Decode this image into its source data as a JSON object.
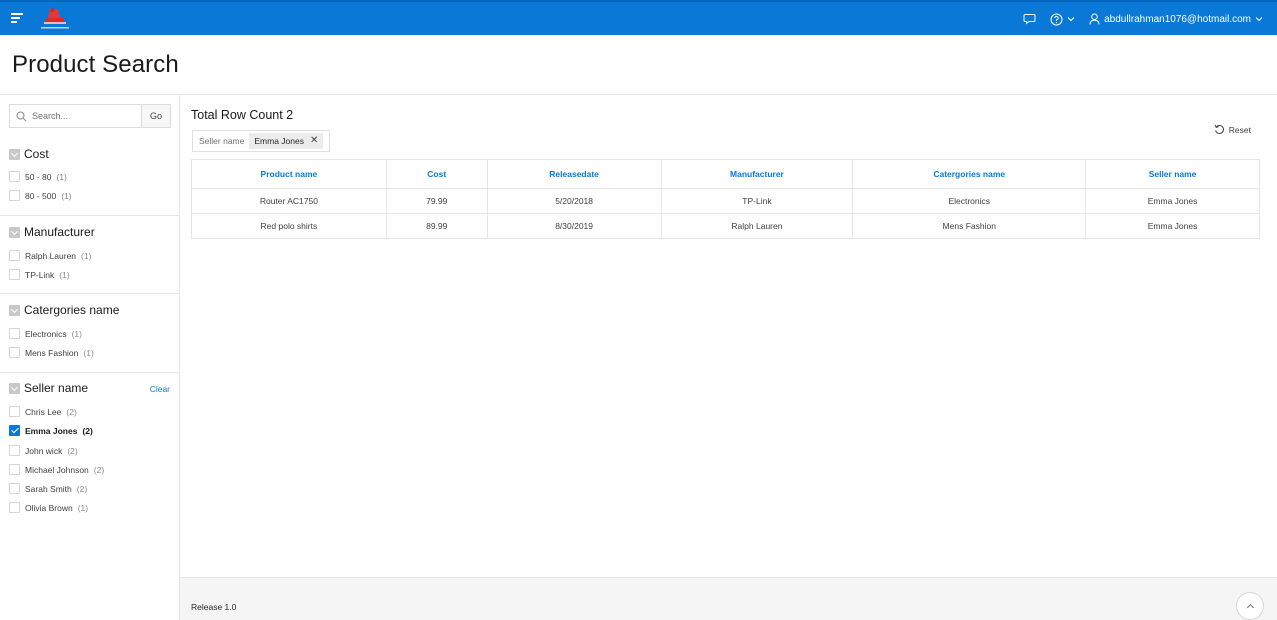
{
  "header": {
    "user_email": "abdullrahman1076@hotmail.com"
  },
  "page": {
    "title": "Product Search"
  },
  "search": {
    "placeholder": "Search...",
    "go_label": "Go"
  },
  "facets": [
    {
      "title": "Cost",
      "options": [
        {
          "label": "50 - 80",
          "count": "(1)",
          "checked": false
        },
        {
          "label": "80 - 500",
          "count": "(1)",
          "checked": false
        }
      ]
    },
    {
      "title": "Manufacturer",
      "options": [
        {
          "label": "Ralph Lauren",
          "count": "(1)",
          "checked": false
        },
        {
          "label": "TP-Link",
          "count": "(1)",
          "checked": false
        }
      ]
    },
    {
      "title": "Catergories name",
      "options": [
        {
          "label": "Electronics",
          "count": "(1)",
          "checked": false
        },
        {
          "label": "Mens Fashion",
          "count": "(1)",
          "checked": false
        }
      ]
    },
    {
      "title": "Seller name",
      "clear_label": "Clear",
      "options": [
        {
          "label": "Chris Lee",
          "count": "(2)",
          "checked": false
        },
        {
          "label": "Emma Jones",
          "count": "(2)",
          "checked": true
        },
        {
          "label": "John wick",
          "count": "(2)",
          "checked": false
        },
        {
          "label": "Michael Johnson",
          "count": "(2)",
          "checked": false
        },
        {
          "label": "Sarah Smith",
          "count": "(2)",
          "checked": false
        },
        {
          "label": "Olivia Brown",
          "count": "(1)",
          "checked": false
        }
      ]
    }
  ],
  "results": {
    "row_count": "Total Row Count 2",
    "filter_label": "Seller name",
    "filter_value": "Emma Jones",
    "reset_label": "Reset",
    "columns": [
      "Product name",
      "Cost",
      "Releasedate",
      "Manufacturer",
      "Catergories name",
      "Seller name"
    ],
    "rows": [
      [
        "Router AC1750",
        "79.99",
        "5/20/2018",
        "TP-Link",
        "Electronics",
        "Emma Jones"
      ],
      [
        "Red polo shirts",
        "89.99",
        "8/30/2019",
        "Ralph Lauren",
        "Mens Fashion",
        "Emma Jones"
      ]
    ]
  },
  "footer": {
    "release": "Release 1.0"
  },
  "colors": {
    "accent": "#0a78d7",
    "header_bg": "#0a78d7"
  }
}
